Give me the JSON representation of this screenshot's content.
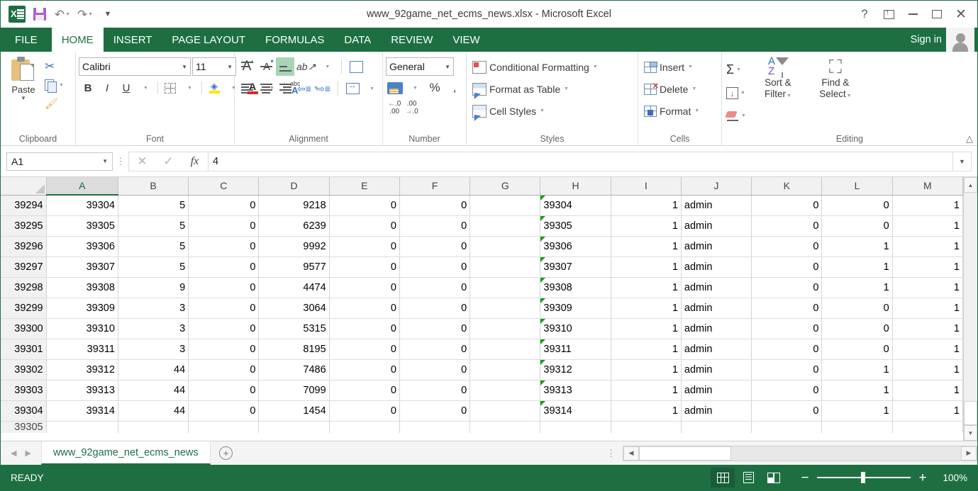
{
  "titlebar": {
    "document_title": "www_92game_net_ecms_news.xlsx - Microsoft Excel",
    "qat": {
      "logo": "excel-logo",
      "save": "Save",
      "undo": "Undo",
      "redo": "Redo",
      "customize": "Customize Quick Access Toolbar"
    },
    "window": {
      "help": "?",
      "ribbon_display": "Ribbon Display Options",
      "minimize": "Minimize",
      "maximize": "Maximize",
      "close": "✕"
    }
  },
  "ribbon_tabs": {
    "file": "FILE",
    "items": [
      {
        "label": "HOME",
        "active": true
      },
      {
        "label": "INSERT",
        "active": false
      },
      {
        "label": "PAGE LAYOUT",
        "active": false
      },
      {
        "label": "FORMULAS",
        "active": false
      },
      {
        "label": "DATA",
        "active": false
      },
      {
        "label": "REVIEW",
        "active": false
      },
      {
        "label": "VIEW",
        "active": false
      }
    ],
    "sign_in": "Sign in"
  },
  "ribbon": {
    "clipboard": {
      "group_label": "Clipboard",
      "paste_label": "Paste",
      "cut": "Cut",
      "copy": "Copy",
      "format_painter": "Format Painter"
    },
    "font": {
      "group_label": "Font",
      "font_name": "Calibri",
      "font_size": "11",
      "grow_font": "A",
      "shrink_font": "A",
      "bold": "B",
      "italic": "I",
      "underline": "U",
      "borders": "Borders",
      "fill_color": "Fill Color",
      "font_color": "A",
      "phonetic": "abc"
    },
    "alignment": {
      "group_label": "Alignment",
      "top_align": "Top Align",
      "middle_align": "Middle Align",
      "bottom_align": "Bottom Align",
      "orientation": "Orientation",
      "wrap_text": "Wrap Text",
      "merge_center": "Merge & Center",
      "align_left": "Align Left",
      "center": "Center",
      "align_right": "Align Right",
      "decrease_indent": "Decrease Indent",
      "increase_indent": "Increase Indent"
    },
    "number": {
      "group_label": "Number",
      "format": "General",
      "accounting": "Accounting Number Format",
      "percent": "%",
      "comma": ",",
      "increase_decimal": "Increase Decimal",
      "decrease_decimal": "Decrease Decimal"
    },
    "styles": {
      "group_label": "Styles",
      "conditional_formatting": "Conditional Formatting",
      "format_as_table": "Format as Table",
      "cell_styles": "Cell Styles"
    },
    "cells": {
      "group_label": "Cells",
      "insert": "Insert",
      "delete": "Delete",
      "format": "Format"
    },
    "editing": {
      "group_label": "Editing",
      "autosum": "Σ",
      "fill": "Fill",
      "clear": "Clear",
      "sort_filter_l1": "Sort &",
      "sort_filter_l2": "Filter",
      "find_select_l1": "Find &",
      "find_select_l2": "Select"
    },
    "collapse": "Collapse the Ribbon"
  },
  "formula_bar": {
    "name_box": "A1",
    "cancel": "✕",
    "enter": "✓",
    "insert_function": "fx",
    "content": "4"
  },
  "grid": {
    "columns": [
      "A",
      "B",
      "C",
      "D",
      "E",
      "F",
      "G",
      "H",
      "I",
      "J",
      "K",
      "L",
      "M"
    ],
    "selected_column": "A",
    "rows": [
      {
        "header": "39294",
        "cells": [
          "39304",
          "5",
          "0",
          "9218",
          "0",
          "0",
          "",
          "39304",
          "1",
          "admin",
          "0",
          "0",
          "1"
        ]
      },
      {
        "header": "39295",
        "cells": [
          "39305",
          "5",
          "0",
          "6239",
          "0",
          "0",
          "",
          "39305",
          "1",
          "admin",
          "0",
          "0",
          "1"
        ]
      },
      {
        "header": "39296",
        "cells": [
          "39306",
          "5",
          "0",
          "9992",
          "0",
          "0",
          "",
          "39306",
          "1",
          "admin",
          "0",
          "1",
          "1"
        ]
      },
      {
        "header": "39297",
        "cells": [
          "39307",
          "5",
          "0",
          "9577",
          "0",
          "0",
          "",
          "39307",
          "1",
          "admin",
          "0",
          "1",
          "1"
        ]
      },
      {
        "header": "39298",
        "cells": [
          "39308",
          "9",
          "0",
          "4474",
          "0",
          "0",
          "",
          "39308",
          "1",
          "admin",
          "0",
          "1",
          "1"
        ]
      },
      {
        "header": "39299",
        "cells": [
          "39309",
          "3",
          "0",
          "3064",
          "0",
          "0",
          "",
          "39309",
          "1",
          "admin",
          "0",
          "0",
          "1"
        ]
      },
      {
        "header": "39300",
        "cells": [
          "39310",
          "3",
          "0",
          "5315",
          "0",
          "0",
          "",
          "39310",
          "1",
          "admin",
          "0",
          "0",
          "1"
        ]
      },
      {
        "header": "39301",
        "cells": [
          "39311",
          "3",
          "0",
          "8195",
          "0",
          "0",
          "",
          "39311",
          "1",
          "admin",
          "0",
          "0",
          "1"
        ]
      },
      {
        "header": "39302",
        "cells": [
          "39312",
          "44",
          "0",
          "7486",
          "0",
          "0",
          "",
          "39312",
          "1",
          "admin",
          "0",
          "1",
          "1"
        ]
      },
      {
        "header": "39303",
        "cells": [
          "39313",
          "44",
          "0",
          "7099",
          "0",
          "0",
          "",
          "39313",
          "1",
          "admin",
          "0",
          "1",
          "1"
        ]
      },
      {
        "header": "39304",
        "cells": [
          "39314",
          "44",
          "0",
          "1454",
          "0",
          "0",
          "",
          "39314",
          "1",
          "admin",
          "0",
          "1",
          "1"
        ]
      }
    ],
    "partial_row_header": "39305"
  },
  "sheet_tabs": {
    "prev": "◀",
    "next": "▶",
    "tabs": [
      {
        "label": "www_92game_net_ecms_news",
        "active": true
      }
    ],
    "new_sheet": "+"
  },
  "status_bar": {
    "status": "READY",
    "view_normal": "Normal",
    "view_page_layout": "Page Layout",
    "view_page_break": "Page Break Preview",
    "zoom_out": "−",
    "zoom_in": "+",
    "zoom_level": "100%"
  },
  "colors": {
    "excel_green": "#1d6f42",
    "accent_highlight": "#a8d5b5",
    "error_triangle": "#169e16"
  }
}
